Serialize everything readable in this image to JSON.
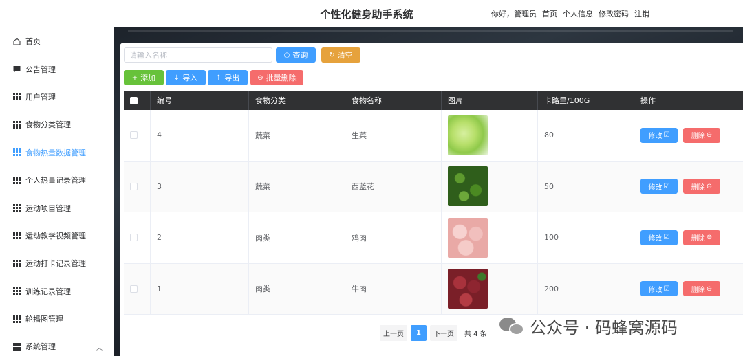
{
  "header": {
    "title": "个性化健身助手系统",
    "greeting": "你好，管理员",
    "nav": [
      "首页",
      "个人信息",
      "修改密码",
      "注销"
    ]
  },
  "sidebar": {
    "items": [
      {
        "label": "首页",
        "icon": "home-icon"
      },
      {
        "label": "公告管理",
        "icon": "message-icon"
      },
      {
        "label": "用户管理",
        "icon": "grid-icon"
      },
      {
        "label": "食物分类管理",
        "icon": "grid-icon"
      },
      {
        "label": "食物热量数据管理",
        "icon": "grid-icon",
        "active": true
      },
      {
        "label": "个人热量记录管理",
        "icon": "grid-icon"
      },
      {
        "label": "运动项目管理",
        "icon": "grid-icon"
      },
      {
        "label": "运动教学视频管理",
        "icon": "grid-icon"
      },
      {
        "label": "运动打卡记录管理",
        "icon": "grid-icon"
      },
      {
        "label": "训练记录管理",
        "icon": "grid-icon"
      },
      {
        "label": "轮播图管理",
        "icon": "grid-icon"
      },
      {
        "label": "系统管理",
        "icon": "apps-icon",
        "expandable": true
      }
    ]
  },
  "search": {
    "placeholder": "请输入名称",
    "query_label": "查询",
    "reset_label": "清空"
  },
  "toolbar": {
    "add_label": "添加",
    "import_label": "导入",
    "export_label": "导出",
    "batch_delete_label": "批量删除"
  },
  "table": {
    "columns": [
      "编号",
      "食物分类",
      "食物名称",
      "图片",
      "卡路里/100G",
      "操作"
    ],
    "edit_label": "修改",
    "delete_label": "删除",
    "rows": [
      {
        "id": "4",
        "category": "蔬菜",
        "name": "生菜",
        "image": "lettuce-image",
        "calories": "80"
      },
      {
        "id": "3",
        "category": "蔬菜",
        "name": "西蓝花",
        "image": "broccoli-image",
        "calories": "50"
      },
      {
        "id": "2",
        "category": "肉类",
        "name": "鸡肉",
        "image": "chicken-image",
        "calories": "100"
      },
      {
        "id": "1",
        "category": "肉类",
        "name": "牛肉",
        "image": "beef-image",
        "calories": "200"
      }
    ]
  },
  "pagination": {
    "prev_label": "上一页",
    "current_page": "1",
    "next_label": "下一页",
    "total_label": "共 4 条"
  },
  "watermark": {
    "text": "公众号 · 码蜂窝源码"
  },
  "colors": {
    "primary": "#409eff",
    "success": "#67c23a",
    "warning": "#e6a23c",
    "danger": "#f56c6c",
    "table_header": "#303133"
  }
}
